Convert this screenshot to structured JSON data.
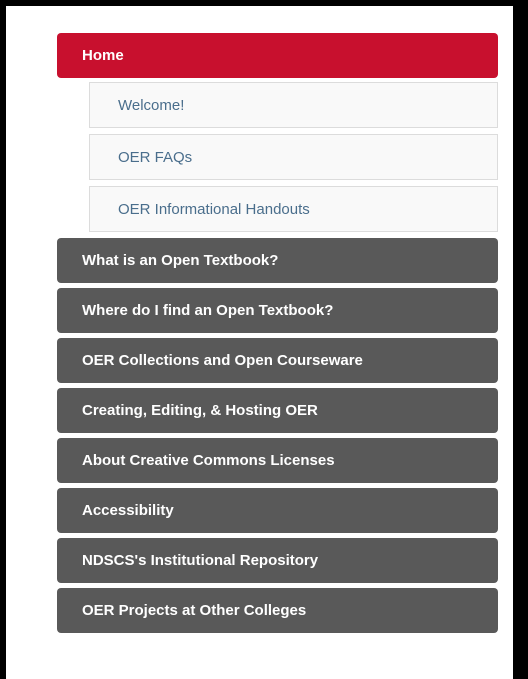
{
  "nav": {
    "home": "Home",
    "sub_items": [
      "Welcome!",
      "OER FAQs",
      "OER Informational Handouts"
    ],
    "items": [
      "What is an Open Textbook?",
      "Where do I find an Open Textbook?",
      "OER Collections and Open Courseware",
      "Creating, Editing, & Hosting OER",
      "About Creative Commons Licenses",
      "Accessibility",
      "NDSCS's Institutional Repository",
      "OER Projects at Other Colleges"
    ]
  },
  "colors": {
    "active": "#c8102e",
    "item": "#595959",
    "sub_link": "#4a6e8c"
  }
}
